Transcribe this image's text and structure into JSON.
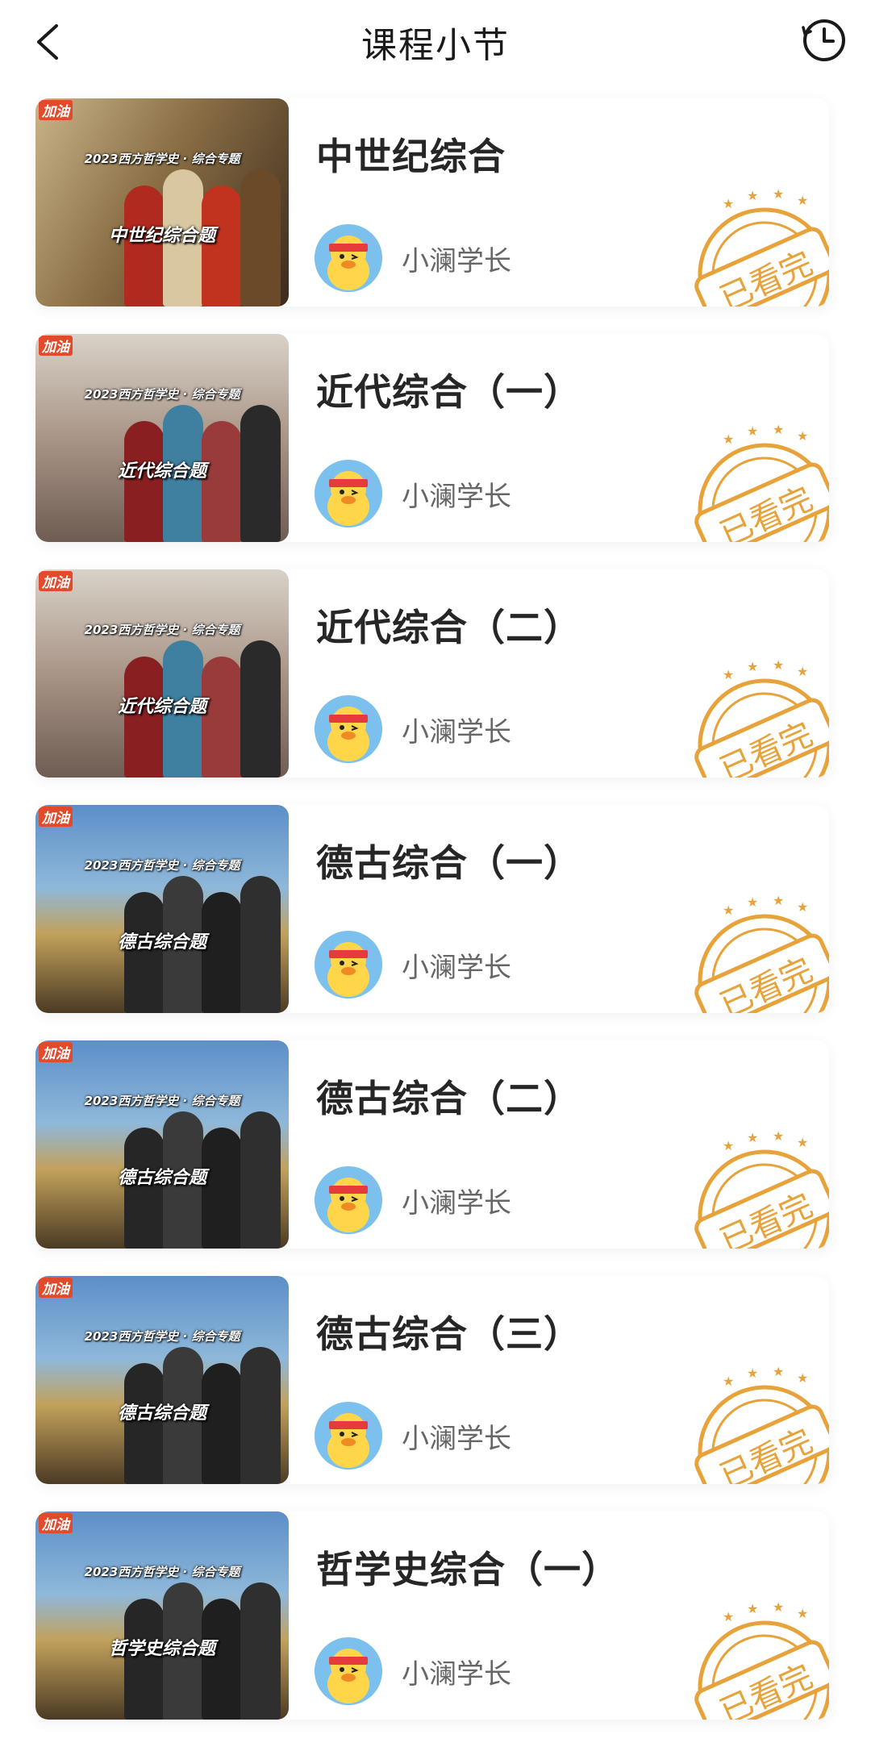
{
  "header": {
    "title": "课程小节"
  },
  "lessons": [
    {
      "title": "中世纪综合",
      "author": "小澜学长",
      "status": "已看完",
      "thumb": {
        "logo": "加油",
        "subtitle": "2023西方哲学史 · 综合专题",
        "caption": "中世纪综合题",
        "theme": "medieval"
      }
    },
    {
      "title": "近代综合（一）",
      "author": "小澜学长",
      "status": "已看完",
      "thumb": {
        "logo": "加油",
        "subtitle": "2023西方哲学史 · 综合专题",
        "caption": "近代综合题",
        "theme": "modern"
      }
    },
    {
      "title": "近代综合（二）",
      "author": "小澜学长",
      "status": "已看完",
      "thumb": {
        "logo": "加油",
        "subtitle": "2023西方哲学史 · 综合专题",
        "caption": "近代综合题",
        "theme": "modern"
      }
    },
    {
      "title": "德古综合（一）",
      "author": "小澜学长",
      "status": "已看完",
      "thumb": {
        "logo": "加油",
        "subtitle": "2023西方哲学史 · 综合专题",
        "caption": "德古综合题",
        "theme": "german"
      }
    },
    {
      "title": "德古综合（二）",
      "author": "小澜学长",
      "status": "已看完",
      "thumb": {
        "logo": "加油",
        "subtitle": "2023西方哲学史 · 综合专题",
        "caption": "德古综合题",
        "theme": "german"
      }
    },
    {
      "title": "德古综合（三）",
      "author": "小澜学长",
      "status": "已看完",
      "thumb": {
        "logo": "加油",
        "subtitle": "2023西方哲学史 · 综合专题",
        "caption": "德古综合题",
        "theme": "german"
      }
    },
    {
      "title": "哲学史综合（一）",
      "author": "小澜学长",
      "status": "已看完",
      "thumb": {
        "logo": "加油",
        "subtitle": "2023西方哲学史 · 综合专题",
        "caption": "哲学史综合题",
        "theme": "german"
      }
    }
  ],
  "colors": {
    "stamp": "#e8a23a",
    "avatar_bg": "#7cc1ee",
    "title_text": "#262626",
    "author_text": "#666666"
  },
  "icons": {
    "back": "chevron-left-icon",
    "history": "clock-icon"
  }
}
